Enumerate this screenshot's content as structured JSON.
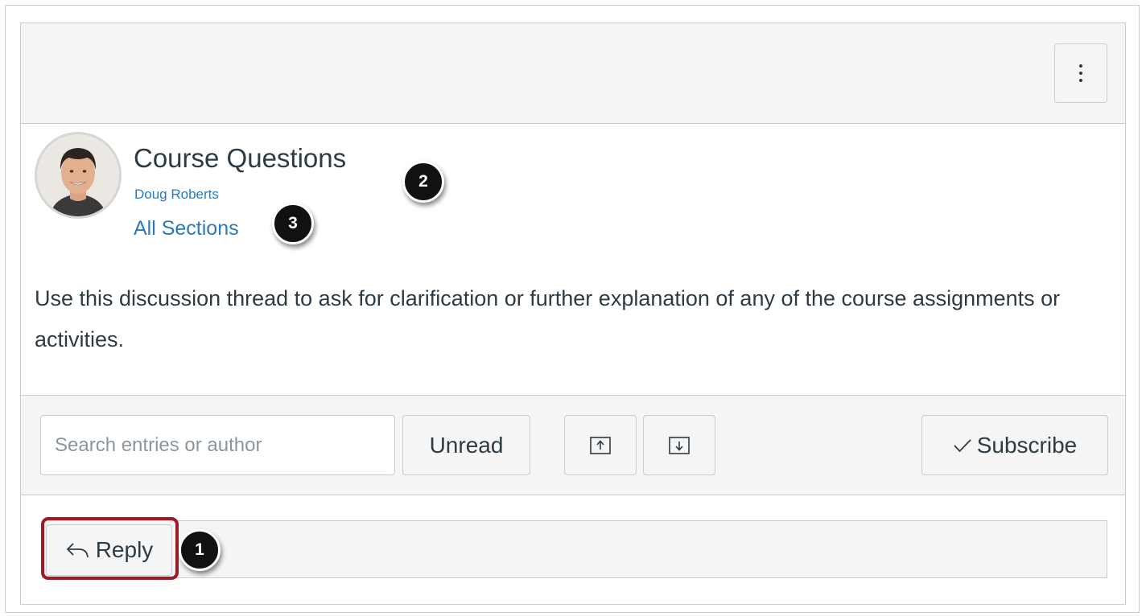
{
  "header": {
    "options_menu_icon": "kebab-vertical-icon"
  },
  "topic": {
    "title": "Course Questions",
    "author": "Doug Roberts",
    "sections": "All Sections",
    "message": "Use this discussion thread to ask for clarification or further explanation of any of the course assignments or activities."
  },
  "toolbar": {
    "search_placeholder": "Search entries or author",
    "search_value": "",
    "unread_label": "Unread",
    "expand_icon": "expand-threads-icon",
    "collapse_icon": "collapse-threads-icon",
    "subscribe_label": "Subscribe",
    "subscribe_icon": "checkmark-icon"
  },
  "reply": {
    "label": "Reply",
    "icon": "reply-arrow-icon"
  },
  "callouts": {
    "reply": "1",
    "title": "2",
    "author": "3"
  },
  "colors": {
    "link": "#2b7abc",
    "text": "#2d3b45",
    "bar_bg": "#f5f5f5",
    "border": "#c7cdd1",
    "highlight": "#9b1c24"
  }
}
